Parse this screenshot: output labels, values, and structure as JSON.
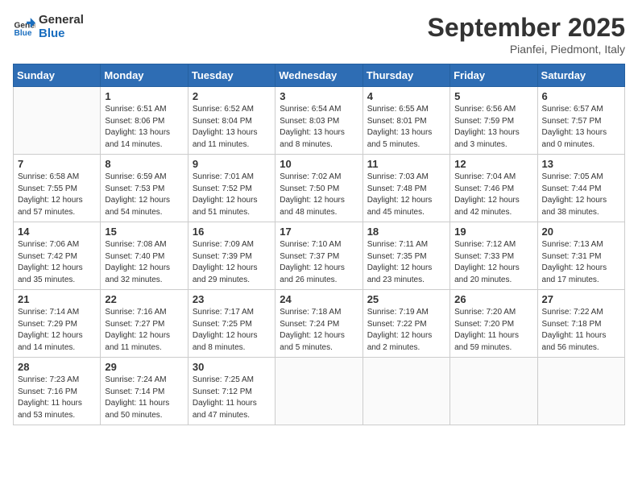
{
  "logo": {
    "line1": "General",
    "line2": "Blue"
  },
  "title": "September 2025",
  "location": "Pianfei, Piedmont, Italy",
  "weekdays": [
    "Sunday",
    "Monday",
    "Tuesday",
    "Wednesday",
    "Thursday",
    "Friday",
    "Saturday"
  ],
  "weeks": [
    [
      {
        "day": "",
        "info": ""
      },
      {
        "day": "1",
        "info": "Sunrise: 6:51 AM\nSunset: 8:06 PM\nDaylight: 13 hours\nand 14 minutes."
      },
      {
        "day": "2",
        "info": "Sunrise: 6:52 AM\nSunset: 8:04 PM\nDaylight: 13 hours\nand 11 minutes."
      },
      {
        "day": "3",
        "info": "Sunrise: 6:54 AM\nSunset: 8:03 PM\nDaylight: 13 hours\nand 8 minutes."
      },
      {
        "day": "4",
        "info": "Sunrise: 6:55 AM\nSunset: 8:01 PM\nDaylight: 13 hours\nand 5 minutes."
      },
      {
        "day": "5",
        "info": "Sunrise: 6:56 AM\nSunset: 7:59 PM\nDaylight: 13 hours\nand 3 minutes."
      },
      {
        "day": "6",
        "info": "Sunrise: 6:57 AM\nSunset: 7:57 PM\nDaylight: 13 hours\nand 0 minutes."
      }
    ],
    [
      {
        "day": "7",
        "info": "Sunrise: 6:58 AM\nSunset: 7:55 PM\nDaylight: 12 hours\nand 57 minutes."
      },
      {
        "day": "8",
        "info": "Sunrise: 6:59 AM\nSunset: 7:53 PM\nDaylight: 12 hours\nand 54 minutes."
      },
      {
        "day": "9",
        "info": "Sunrise: 7:01 AM\nSunset: 7:52 PM\nDaylight: 12 hours\nand 51 minutes."
      },
      {
        "day": "10",
        "info": "Sunrise: 7:02 AM\nSunset: 7:50 PM\nDaylight: 12 hours\nand 48 minutes."
      },
      {
        "day": "11",
        "info": "Sunrise: 7:03 AM\nSunset: 7:48 PM\nDaylight: 12 hours\nand 45 minutes."
      },
      {
        "day": "12",
        "info": "Sunrise: 7:04 AM\nSunset: 7:46 PM\nDaylight: 12 hours\nand 42 minutes."
      },
      {
        "day": "13",
        "info": "Sunrise: 7:05 AM\nSunset: 7:44 PM\nDaylight: 12 hours\nand 38 minutes."
      }
    ],
    [
      {
        "day": "14",
        "info": "Sunrise: 7:06 AM\nSunset: 7:42 PM\nDaylight: 12 hours\nand 35 minutes."
      },
      {
        "day": "15",
        "info": "Sunrise: 7:08 AM\nSunset: 7:40 PM\nDaylight: 12 hours\nand 32 minutes."
      },
      {
        "day": "16",
        "info": "Sunrise: 7:09 AM\nSunset: 7:39 PM\nDaylight: 12 hours\nand 29 minutes."
      },
      {
        "day": "17",
        "info": "Sunrise: 7:10 AM\nSunset: 7:37 PM\nDaylight: 12 hours\nand 26 minutes."
      },
      {
        "day": "18",
        "info": "Sunrise: 7:11 AM\nSunset: 7:35 PM\nDaylight: 12 hours\nand 23 minutes."
      },
      {
        "day": "19",
        "info": "Sunrise: 7:12 AM\nSunset: 7:33 PM\nDaylight: 12 hours\nand 20 minutes."
      },
      {
        "day": "20",
        "info": "Sunrise: 7:13 AM\nSunset: 7:31 PM\nDaylight: 12 hours\nand 17 minutes."
      }
    ],
    [
      {
        "day": "21",
        "info": "Sunrise: 7:14 AM\nSunset: 7:29 PM\nDaylight: 12 hours\nand 14 minutes."
      },
      {
        "day": "22",
        "info": "Sunrise: 7:16 AM\nSunset: 7:27 PM\nDaylight: 12 hours\nand 11 minutes."
      },
      {
        "day": "23",
        "info": "Sunrise: 7:17 AM\nSunset: 7:25 PM\nDaylight: 12 hours\nand 8 minutes."
      },
      {
        "day": "24",
        "info": "Sunrise: 7:18 AM\nSunset: 7:24 PM\nDaylight: 12 hours\nand 5 minutes."
      },
      {
        "day": "25",
        "info": "Sunrise: 7:19 AM\nSunset: 7:22 PM\nDaylight: 12 hours\nand 2 minutes."
      },
      {
        "day": "26",
        "info": "Sunrise: 7:20 AM\nSunset: 7:20 PM\nDaylight: 11 hours\nand 59 minutes."
      },
      {
        "day": "27",
        "info": "Sunrise: 7:22 AM\nSunset: 7:18 PM\nDaylight: 11 hours\nand 56 minutes."
      }
    ],
    [
      {
        "day": "28",
        "info": "Sunrise: 7:23 AM\nSunset: 7:16 PM\nDaylight: 11 hours\nand 53 minutes."
      },
      {
        "day": "29",
        "info": "Sunrise: 7:24 AM\nSunset: 7:14 PM\nDaylight: 11 hours\nand 50 minutes."
      },
      {
        "day": "30",
        "info": "Sunrise: 7:25 AM\nSunset: 7:12 PM\nDaylight: 11 hours\nand 47 minutes."
      },
      {
        "day": "",
        "info": ""
      },
      {
        "day": "",
        "info": ""
      },
      {
        "day": "",
        "info": ""
      },
      {
        "day": "",
        "info": ""
      }
    ]
  ]
}
